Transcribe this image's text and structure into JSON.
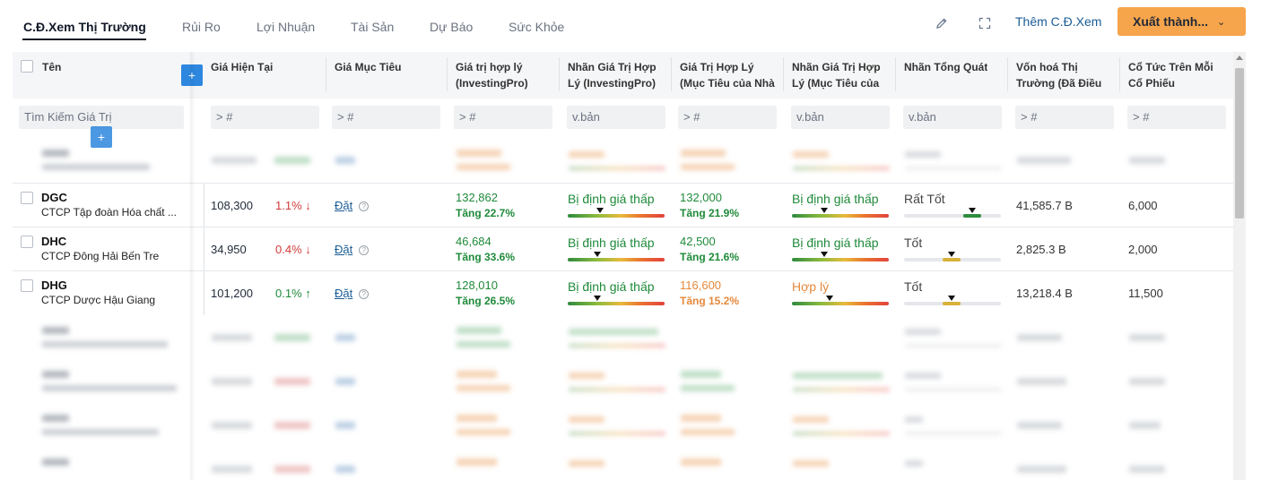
{
  "tabs": [
    {
      "label": "C.Đ.Xem Thị Trường",
      "active": true
    },
    {
      "label": "Rủi Ro"
    },
    {
      "label": "Lợi Nhuận"
    },
    {
      "label": "Tài Sản"
    },
    {
      "label": "Dự Báo"
    },
    {
      "label": "Sức Khỏe"
    }
  ],
  "toolbar": {
    "edit_icon": "pencil-icon",
    "fullscreen_icon": "expand-icon",
    "add_view_label": "Thêm C.Đ.Xem",
    "export_label": "Xuất thành...",
    "export_chevron": "⌄"
  },
  "columns": [
    "Tên",
    "Giá Hiện Tại",
    "Giá Mục Tiêu",
    "Giá trị hợp lý (InvestingPro)",
    "Nhãn Giá Trị Hợp Lý (InvestingPro)",
    "Giá Trị Hợp Lý (Mục Tiêu của Nhà",
    "Nhãn Giá Trị Hợp Lý (Mục Tiêu của",
    "Nhãn Tổng Quát",
    "Vốn hoá Thị Trường (Đã Điều",
    "Cổ Tức Trên Mỗi Cổ Phiếu"
  ],
  "filters": {
    "name_placeholder": "Tìm Kiếm Giá Trị",
    "price": "> #",
    "target": "> #",
    "fair_value": "> #",
    "fair_label": "v.bản",
    "analyst_value": "> #",
    "analyst_label": "v.bản",
    "overall_label": "v.bản",
    "market_cap": "> #",
    "dividend": "> #"
  },
  "plus_label": "+",
  "rows": [
    {
      "symbol": "DGC",
      "name": "CTCP Tập đoàn Hóa chất ...",
      "price": "108,300",
      "change": "1.1%",
      "change_dir": "↓",
      "target_link": "Đặt",
      "fair_value": "132,862",
      "fair_upside": "Tăng 22.7%",
      "fair_label": "Bị định giá thấp",
      "fair_gauge": 0.33,
      "analyst_value": "132,000",
      "analyst_upside": "Tăng 21.9%",
      "analyst_label": "Bị định giá thấp",
      "analyst_gauge": 0.33,
      "overall_label": "Rất Tốt",
      "overall_score": 0.7,
      "market_cap": "41,585.7 B",
      "dividend": "6,000"
    },
    {
      "symbol": "DHC",
      "name": "CTCP Đông Hải Bến Tre",
      "price": "34,950",
      "change": "0.4%",
      "change_dir": "↓",
      "target_link": "Đặt",
      "fair_value": "46,684",
      "fair_upside": "Tăng 33.6%",
      "fair_label": "Bị định giá thấp",
      "fair_gauge": 0.31,
      "analyst_value": "42,500",
      "analyst_upside": "Tăng 21.6%",
      "analyst_label": "Bị định giá thấp",
      "analyst_gauge": 0.33,
      "overall_label": "Tốt",
      "overall_score": 0.49,
      "market_cap": "2,825.3 B",
      "dividend": "2,000"
    },
    {
      "symbol": "DHG",
      "name": "CTCP Dược Hậu Giang",
      "price": "101,200",
      "change": "0.1%",
      "change_dir": "↑",
      "target_link": "Đặt",
      "fair_value": "128,010",
      "fair_upside": "Tăng 26.5%",
      "fair_label": "Bị định giá thấp",
      "fair_gauge": 0.31,
      "analyst_value": "116,600",
      "analyst_upside": "Tăng 15.2%",
      "analyst_label": "Hợp lý",
      "analyst_gauge": 0.39,
      "overall_label": "Tốt",
      "overall_score": 0.49,
      "market_cap": "13,218.4 B",
      "dividend": "11,500"
    }
  ]
}
